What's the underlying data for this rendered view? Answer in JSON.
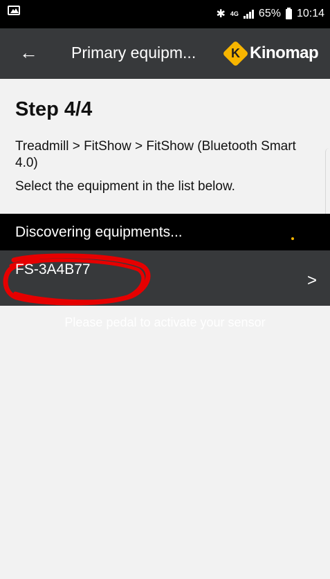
{
  "status_bar": {
    "network": "4G",
    "battery": "65%",
    "time": "10:14"
  },
  "app_bar": {
    "title": "Primary equipm...",
    "brand": "Kinomap",
    "logo_letter": "K"
  },
  "content": {
    "step_title": "Step 4/4",
    "path": "Treadmill > FitShow > FitShow (Bluetooth Smart 4.0)",
    "instruction": "Select the equipment in the list below."
  },
  "discovery": {
    "status_text": "Discovering equipments..."
  },
  "devices": [
    {
      "name": "FS-3A4B77",
      "chevron": ">"
    }
  ],
  "hint": "Please pedal to activate your sensor",
  "colors": {
    "accent": "#f7b500",
    "toolbar": "#37393b",
    "annotation": "#e60000"
  },
  "icons": {
    "gallery": "gallery-icon",
    "bluetooth": "bluetooth-icon",
    "signal": "signal-icon",
    "battery": "battery-icon",
    "back": "back-arrow-icon",
    "chevron": "chevron-right-icon"
  }
}
